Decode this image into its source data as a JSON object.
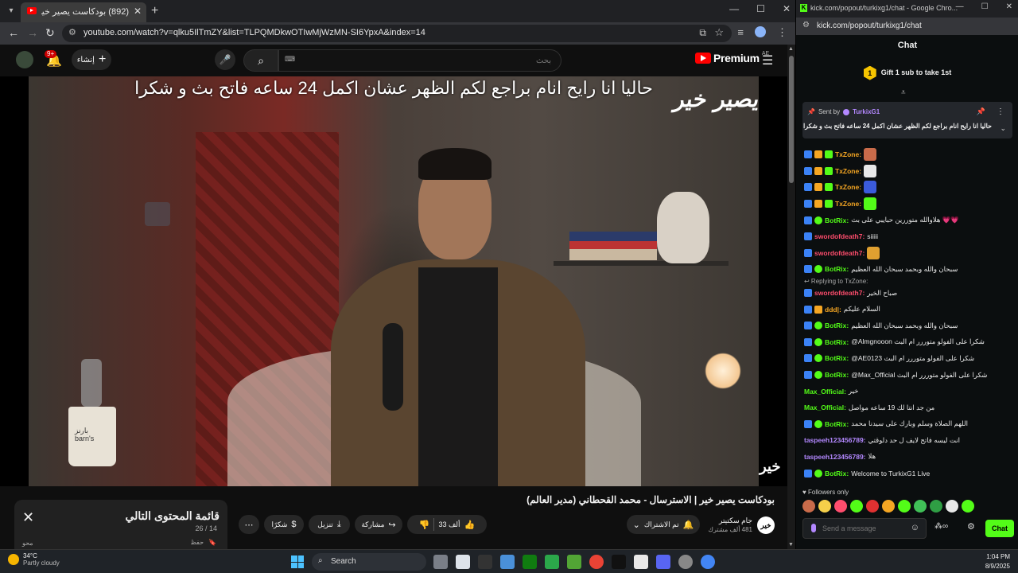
{
  "youtube_browser": {
    "tab_title": "(892) بودكاست يصير خير | الا",
    "url": "youtube.com/watch?v=qlku5IlTmZY&list=TLPQMDkwOTIwMjWzMN-SI6YpxA&index=14",
    "notification_count": "9+",
    "create_label": "إنشاء",
    "search_placeholder": "بحث",
    "logo_text": "Premium",
    "logo_region": "AE"
  },
  "video": {
    "caption": "حاليا انا رايح انام براجع لكم الظهر عشان اكمل 24 ساعه فاتح بث و شكرا",
    "brand_logo": "يصير خير",
    "corner_mark": "خير",
    "cup_text": "بارنز\nbarn's",
    "title": "بودكاست يصير خير | الاسترسال - محمد القحطاني (مدير العالم)",
    "channel_name": "جام سكتيتر",
    "channel_subs": "481 ألف مشترك",
    "channel_avatar_text": "خير",
    "subscribe_label": "تم الاشتراك",
    "likes": "33 ألف",
    "share_label": "مشاركة",
    "download_label": "تنزيل",
    "thanks_label": "شكرًا"
  },
  "playlist": {
    "title": "قائمة المحتوى التالي",
    "count": "26 / 14",
    "save_label": "حفظ",
    "owner": "محو"
  },
  "kick_browser": {
    "window_title": "kick.com/popout/turkixg1/chat - Google Chro...",
    "url": "kick.com/popout/turkixg1/chat",
    "header": "Chat",
    "gift_number": "1",
    "gift_text": "Gift 1 sub to take 1st",
    "pinned_sent_by_label": "Sent by",
    "pinned_user": "TurkixG1",
    "pinned_message": "حاليا انا رايح انام براجع لكم الظهر عشان اكمل 24 ساعه فاتح بث و شكرا",
    "followers_only": "Followers only",
    "input_placeholder": "Send a message",
    "chat_button": "Chat"
  },
  "chat_messages": [
    {
      "user": "TxZone:",
      "text": "",
      "color": "#f5a623",
      "badges": [
        "mod",
        "crown",
        "sub"
      ],
      "emote": "#c96b4a"
    },
    {
      "user": "TxZone:",
      "text": "",
      "color": "#f5a623",
      "badges": [
        "mod",
        "crown",
        "sub"
      ],
      "emote": "#e8e8e8"
    },
    {
      "user": "TxZone:",
      "text": "",
      "color": "#f5a623",
      "badges": [
        "mod",
        "crown",
        "sub"
      ],
      "emote": "#3b5bdb"
    },
    {
      "user": "TxZone:",
      "text": "",
      "color": "#f5a623",
      "badges": [
        "mod",
        "crown",
        "sub"
      ],
      "emote": "#53fc18"
    },
    {
      "user": "BotRix:",
      "text": "هلاوالله متوررين حبايبي على بث 💗💗",
      "color": "#53fc18",
      "badges": [
        "mod",
        "ver"
      ],
      "emote": ""
    },
    {
      "user": "swordofdeath7:",
      "text": "siiiii",
      "color": "#ff4d6d",
      "badges": [
        "mod"
      ],
      "emote": ""
    },
    {
      "user": "swordofdeath7:",
      "text": "",
      "color": "#ff4d6d",
      "badges": [
        "mod"
      ],
      "emote": "#e0a030"
    },
    {
      "user": "BotRix:",
      "text": "سبحان والله وبحمد سبحان الله العظيم",
      "color": "#53fc18",
      "badges": [
        "mod",
        "ver"
      ],
      "emote": ""
    },
    {
      "user": "swordofdeath7:",
      "text": "صباح الخير",
      "color": "#ff4d6d",
      "badges": [
        "mod"
      ],
      "emote": "",
      "reply": "Replying to TxZone:"
    },
    {
      "user": "ddd|:",
      "text": "السلام عليكم",
      "color": "#f5a623",
      "badges": [
        "mod",
        "crown"
      ],
      "emote": ""
    },
    {
      "user": "BotRix:",
      "text": "سبحان والله وبحمد سبحان الله العظيم",
      "color": "#53fc18",
      "badges": [
        "mod",
        "ver"
      ],
      "emote": ""
    },
    {
      "user": "BotRix:",
      "text": "@Almgnooon شكرا على الفولو متوررر ام البث",
      "color": "#53fc18",
      "badges": [
        "mod",
        "ver"
      ],
      "emote": ""
    },
    {
      "user": "BotRix:",
      "text": "@AE0123 شكرا على الفولو متوررر ام البث",
      "color": "#53fc18",
      "badges": [
        "mod",
        "ver"
      ],
      "emote": ""
    },
    {
      "user": "BotRix:",
      "text": "@Max_Official شكرا على الفولو متوررر ام البث",
      "color": "#53fc18",
      "badges": [
        "mod",
        "ver"
      ],
      "emote": ""
    },
    {
      "user": "Max_Official:",
      "text": "خير",
      "color": "#53fc18",
      "badges": [],
      "emote": ""
    },
    {
      "user": "Max_Official:",
      "text": "من جد انتا لك 19 ساعه مواصل",
      "color": "#53fc18",
      "badges": [],
      "emote": ""
    },
    {
      "user": "BotRix:",
      "text": "اللهم الصلاة وسلم وبارك على سيدنا محمد",
      "color": "#53fc18",
      "badges": [
        "mod",
        "ver"
      ],
      "emote": ""
    },
    {
      "user": "taspeeh123456789:",
      "text": "انت ليسه فاتح لايف ل حد دلوقتي",
      "color": "#b388ff",
      "badges": [],
      "emote": ""
    },
    {
      "user": "taspeeh123456789:",
      "text": "هلا",
      "color": "#b388ff",
      "badges": [],
      "emote": ""
    },
    {
      "user": "BotRix:",
      "text": "Welcome to TurkixG1 Live",
      "color": "#53fc18",
      "badges": [
        "mod",
        "ver"
      ],
      "emote": ""
    }
  ],
  "taskbar": {
    "temperature": "34°C",
    "weather": "Partly cloudy",
    "search_label": "Search",
    "time": "1:04 PM",
    "date": "8/9/2025"
  }
}
